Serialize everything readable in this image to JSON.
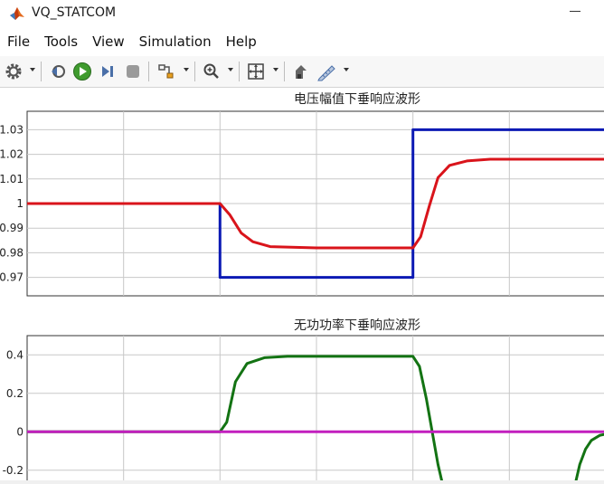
{
  "window": {
    "title": "VQ_STATCOM"
  },
  "menu": [
    "File",
    "Tools",
    "View",
    "Simulation",
    "Help"
  ],
  "toolbar": {
    "icons": [
      "settings-icon",
      "step-back-icon",
      "run-icon",
      "step-forward-icon",
      "stop-icon",
      "signal-select-icon",
      "zoom-icon",
      "fit-to-view-icon",
      "highlight-block-icon",
      "style-icon"
    ]
  },
  "colors": {
    "ref": "#0c1ab4",
    "meas": "#d9141b",
    "q_meas": "#137313",
    "q_ref": "#c21fbe",
    "grid": "#c8c8c8"
  },
  "chart_data": [
    {
      "type": "line",
      "title": "电压幅值下垂响应波形",
      "xlabel": "",
      "ylabel": "",
      "ylim": [
        0.9625,
        1.0375
      ],
      "yticks": [
        0.97,
        0.98,
        0.99,
        1,
        1.01,
        1.02,
        1.03
      ],
      "ytick_labels": [
        "0.97",
        "0.98",
        "0.99",
        "1",
        "1.01",
        "1.02",
        "1.03"
      ],
      "xlim": [
        0,
        1
      ],
      "x_gridlines": [
        0.1667,
        0.3333,
        0.5,
        0.6667,
        0.8333
      ],
      "grid": true,
      "series": [
        {
          "color": "#0c1ab4",
          "x": [
            0,
            0.3333,
            0.3333,
            0.3333,
            0.6667,
            0.6667,
            0.6667,
            1.0
          ],
          "y": [
            1.0,
            1.0,
            0.99,
            0.97,
            0.97,
            1.01,
            1.03,
            1.03
          ]
        },
        {
          "color": "#d9141b",
          "x": [
            0,
            0.3333,
            0.35,
            0.37,
            0.39,
            0.42,
            0.5,
            0.6667,
            0.68,
            0.695,
            0.71,
            0.73,
            0.76,
            0.8,
            0.98,
            1.0
          ],
          "y": [
            1.0,
            1.0,
            0.9955,
            0.988,
            0.9845,
            0.9825,
            0.982,
            0.982,
            0.9865,
            0.999,
            1.0105,
            1.0155,
            1.0173,
            1.018,
            1.018,
            1.018
          ]
        }
      ]
    },
    {
      "type": "line",
      "title": "无功功率下垂响应波形",
      "xlabel": "",
      "ylabel": "",
      "ylim": [
        -0.3,
        0.5
      ],
      "yticks": [
        -0.2,
        0,
        0.2,
        0.4
      ],
      "ytick_labels": [
        "-0.2",
        "0",
        "0.2",
        "0.4"
      ],
      "xlim": [
        0,
        1
      ],
      "x_gridlines": [
        0.1667,
        0.3333,
        0.5,
        0.6667,
        0.8333
      ],
      "grid": true,
      "series": [
        {
          "color": "#137313",
          "x": [
            0,
            0.3333,
            0.345,
            0.36,
            0.38,
            0.41,
            0.45,
            0.6667,
            0.678,
            0.69,
            0.7,
            0.71,
            0.72
          ],
          "y": [
            0,
            0,
            0.05,
            0.26,
            0.355,
            0.385,
            0.392,
            0.392,
            0.34,
            0.17,
            0.0,
            -0.17,
            -0.3
          ]
        },
        {
          "color": "#137313",
          "x": [
            0.945,
            0.955,
            0.965,
            0.975,
            0.99,
            1.01,
            1.04,
            1.1
          ],
          "y": [
            -0.3,
            -0.17,
            -0.09,
            -0.045,
            -0.018,
            -0.007,
            -0.002,
            0
          ]
        },
        {
          "color": "#c21fbe",
          "x": [
            0,
            1.1
          ],
          "y": [
            0,
            0
          ]
        }
      ]
    }
  ]
}
